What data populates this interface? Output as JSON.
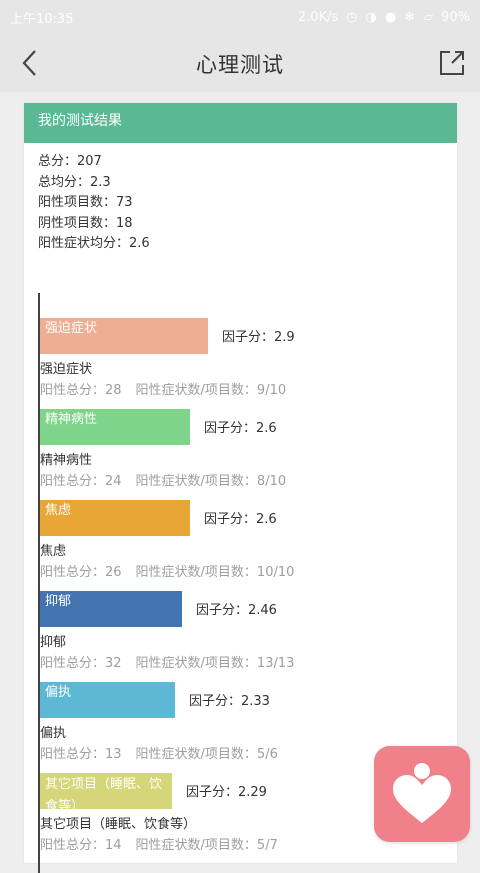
{
  "status_bar": {
    "time": "上午10:35",
    "net_speed": "2.0K/s",
    "battery": "90%"
  },
  "nav": {
    "title": "心理测试",
    "back_icon": "chevron-left-icon",
    "share_icon": "share-icon"
  },
  "result": {
    "header": "我的测试结果",
    "summary": [
      "总分：207",
      "总均分：2.3",
      "阳性项目数：73",
      "阴性项目数：18",
      "阳性症状均分：2.6"
    ]
  },
  "colors": {
    "header_bg": "#5ab894",
    "bar_obsessive": "#eeae93",
    "bar_psychotic": "#7ed488",
    "bar_anxiety": "#e8a636",
    "bar_depression": "#4373b0",
    "bar_paranoid": "#5db8d6",
    "bar_other": "#d5d579",
    "app_badge": "#f0808a"
  },
  "chart_data": {
    "type": "bar",
    "orientation": "horizontal",
    "categories": [
      "强迫症状",
      "精神病性",
      "焦虑",
      "抑郁",
      "偏执",
      "其它项目（睡眠、饮食等）"
    ],
    "values": [
      2.9,
      2.6,
      2.6,
      2.46,
      2.33,
      2.29
    ],
    "score_label_prefix": "因子分：",
    "xlim": [
      0,
      3.15
    ]
  },
  "factors": [
    {
      "bar_label": "强迫症状",
      "score": "因子分：2.9",
      "name": "强迫症状",
      "positive_total": "阳性总分：28",
      "positive_ratio": "阳性症状数/项目数：9/10"
    },
    {
      "bar_label": "精神病性",
      "score": "因子分：2.6",
      "name": "精神病性",
      "positive_total": "阳性总分：24",
      "positive_ratio": "阳性症状数/项目数：8/10"
    },
    {
      "bar_label": "焦虑",
      "score": "因子分：2.6",
      "name": "焦虑",
      "positive_total": "阳性总分：26",
      "positive_ratio": "阳性症状数/项目数：10/10"
    },
    {
      "bar_label": "抑郁",
      "score": "因子分：2.46",
      "name": "抑郁",
      "positive_total": "阳性总分：32",
      "positive_ratio": "阳性症状数/项目数：13/13"
    },
    {
      "bar_label": "偏执",
      "score": "因子分：2.33",
      "name": "偏执",
      "positive_total": "阳性总分：13",
      "positive_ratio": "阳性症状数/项目数：5/6"
    },
    {
      "bar_label": "其它项目（睡眠、饮食等）",
      "score": "因子分：2.29",
      "name": "其它项目（睡眠、饮食等）",
      "positive_total": "阳性总分：14",
      "positive_ratio": "阳性症状数/项目数：5/7"
    }
  ]
}
